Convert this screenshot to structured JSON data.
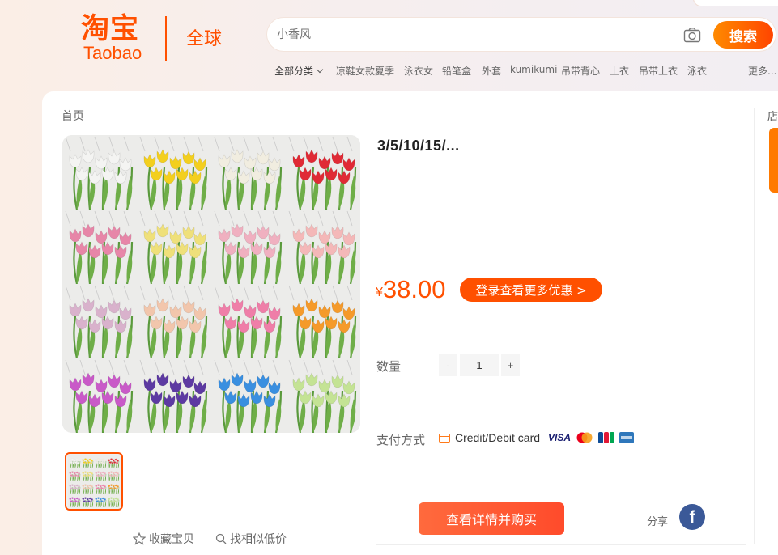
{
  "header": {
    "logo_cn": "淘宝",
    "logo_en": "Taobao",
    "global_label": "全球",
    "search_placeholder": "小香风",
    "search_button": "搜索"
  },
  "hotwords": [
    {
      "label": "全部分类"
    },
    {
      "label": "凉鞋女款夏季"
    },
    {
      "label": "泳衣女"
    },
    {
      "label": "铅笔盒"
    },
    {
      "label": "外套"
    },
    {
      "label": "kumikumi"
    },
    {
      "label": "吊带背心"
    },
    {
      "label": "上衣"
    },
    {
      "label": "吊带上衣"
    },
    {
      "label": "泳衣"
    },
    {
      "label": "更多..."
    }
  ],
  "breadcrumb": "首页",
  "product": {
    "title": "3/5/10/15/...",
    "currency": "¥",
    "price": "38.00",
    "login_button": "登录查看更多优惠 >",
    "quantity_label": "数量",
    "quantity": "1",
    "minus": "-",
    "plus": "+",
    "payment_label": "支付方式",
    "payment_method": "Credit/Debit card",
    "buy_button": "查看详情并购买",
    "share_label": "分享",
    "fb_glyph": "f"
  },
  "gallery_actions": {
    "favorite": "收藏宝贝",
    "similar": "找相似低价"
  },
  "side_label": "店",
  "tulip_colors": [
    "#f4f4f2",
    "#f3cf1e",
    "#f1ede0",
    "#e02a35",
    "#e786a8",
    "#efe07a",
    "#f0b0c0",
    "#f4b8b8",
    "#d9b2cc",
    "#f2c6ac",
    "#ef7ea8",
    "#f59a2a",
    "#c95ac8",
    "#5d3aa2",
    "#3a8fe0",
    "#c4e394"
  ],
  "brand_colors": {
    "accent": "#ff5000",
    "facebook": "#3b5998"
  }
}
